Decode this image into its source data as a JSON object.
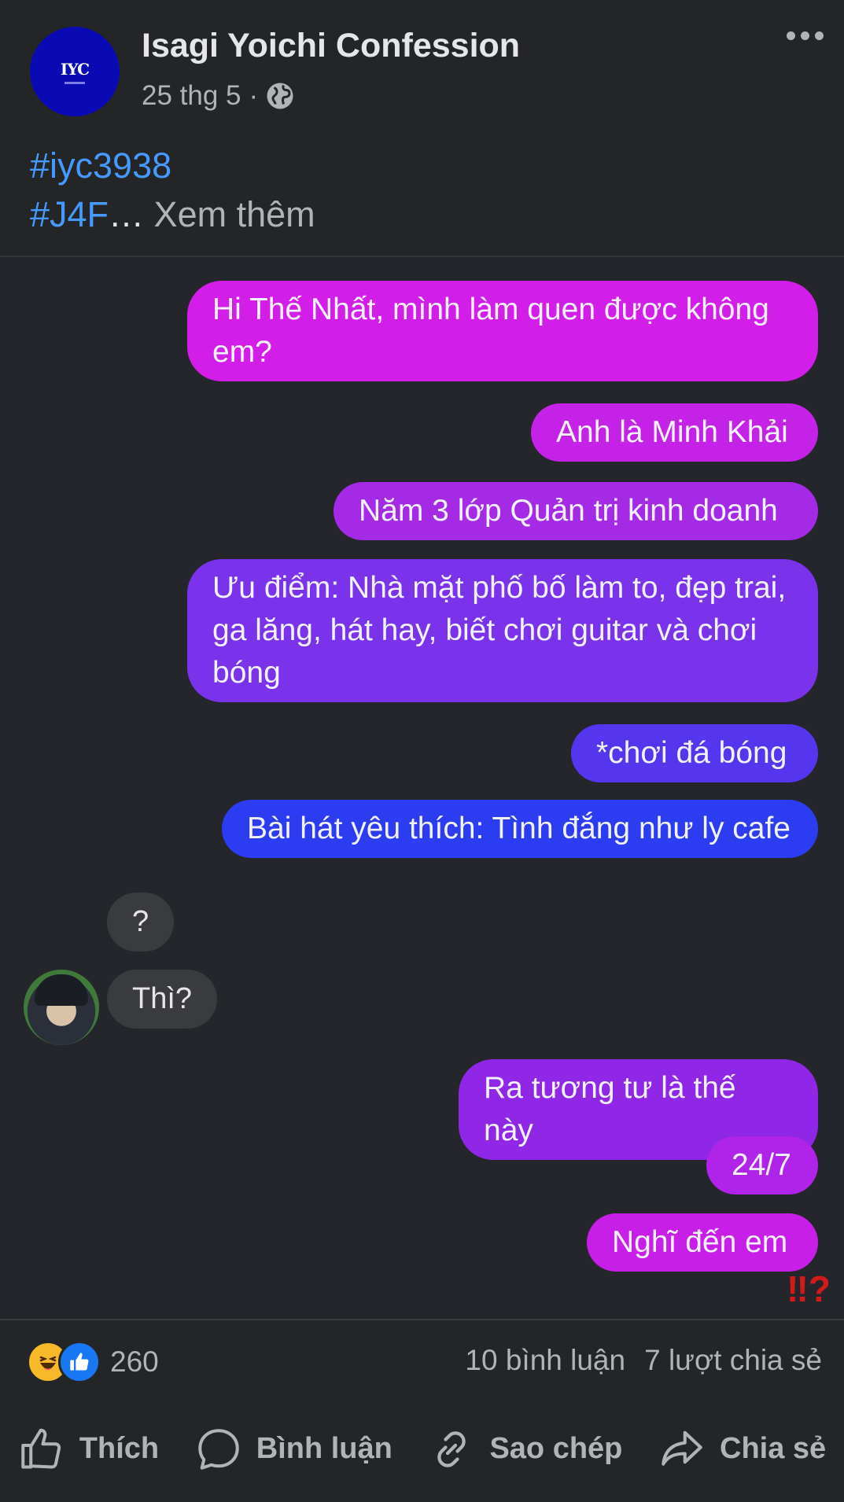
{
  "post": {
    "page_name": "Isagi Yoichi Confession",
    "avatar_text": "IYC",
    "date": "25 thg 5",
    "separator": "·",
    "tag1": "#iyc3938",
    "tag2": "#J4F",
    "ellipsis": "…",
    "see_more": " Xem thêm"
  },
  "chat": {
    "outgoing": [
      "Hi Thế Nhất, mình làm quen được không em?",
      "Anh là Minh Khải",
      "Năm 3 lớp Quản trị kinh doanh",
      "Ưu điểm: Nhà mặt phố bố làm to, đẹp trai, ga lăng, hát hay, biết chơi guitar và chơi bóng",
      "*chơi đá bóng",
      "Bài hát yêu thích: Tình đắng như ly cafe",
      "Ra tương tư là thế này",
      "24/7",
      "Nghĩ đến em"
    ],
    "incoming": [
      "?",
      "Thì?"
    ],
    "reaction": "‼?",
    "colors": {
      "pink": "#d21ee8",
      "purple": "#8a2be2",
      "blue": "#2c3cf0"
    }
  },
  "stats": {
    "reaction_count": "260",
    "comments": "10 bình luận",
    "shares": "7 lượt chia sẻ"
  },
  "actions": {
    "like": "Thích",
    "comment": "Bình luận",
    "copy": "Sao chép",
    "share": "Chia sẻ"
  }
}
